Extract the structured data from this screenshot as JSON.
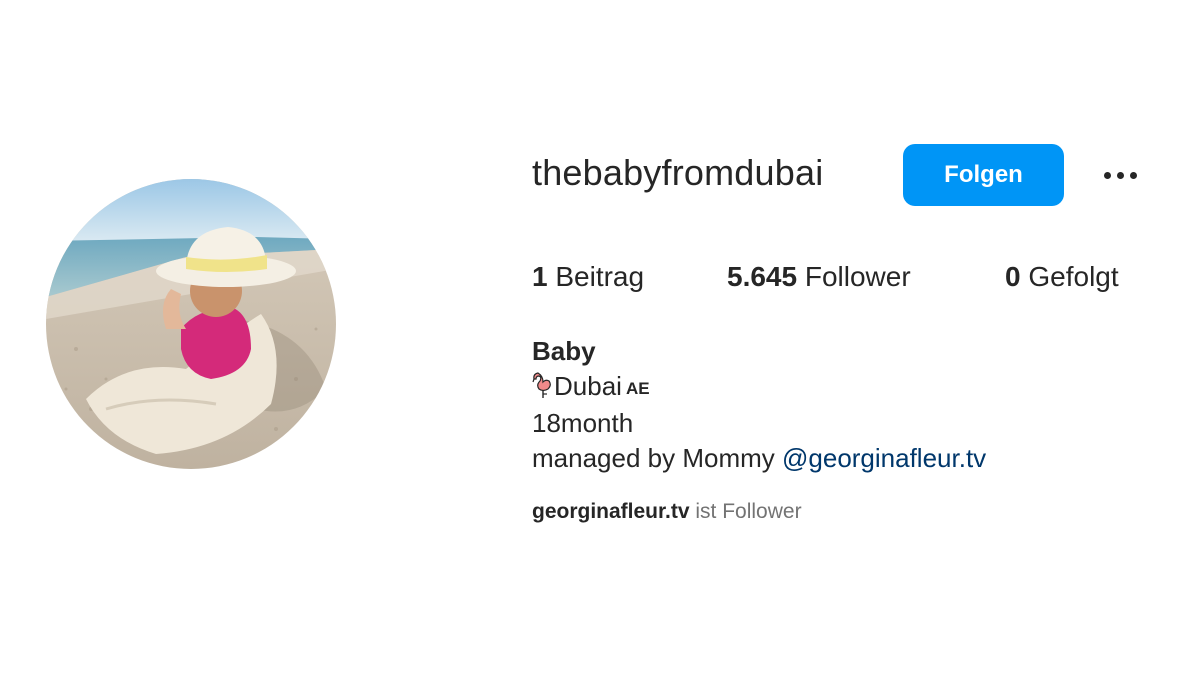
{
  "profile": {
    "username": "thebabyfromdubai",
    "avatar_alt": "profile-picture"
  },
  "actions": {
    "follow_label": "Folgen",
    "more_icon": "more-horizontal-icon"
  },
  "stats": {
    "posts_count": "1",
    "posts_label": "Beitrag",
    "followers_count": "5.645",
    "followers_label": "Follower",
    "following_count": "0",
    "following_label": "Gefolgt"
  },
  "bio": {
    "name": "Baby",
    "location_icon": "flamingo-icon",
    "location": "Dubai",
    "flag_code": "AE",
    "age": "18month",
    "managed_text": "managed by Mommy",
    "managed_mention": "@georginafleur.tv"
  },
  "followed_by": {
    "user": "georginafleur.tv",
    "text": "ist Follower"
  },
  "colors": {
    "accent": "#0095f6",
    "text": "#262626",
    "secondary_text": "#737373",
    "link": "#00376b"
  }
}
